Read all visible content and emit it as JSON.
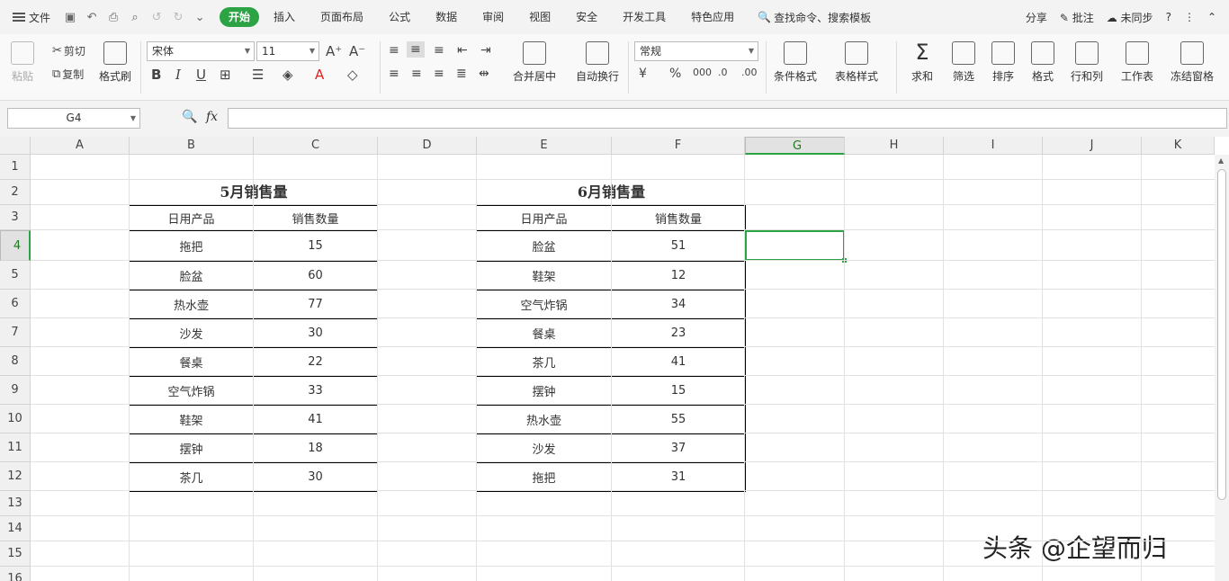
{
  "menu": {
    "file": "文件",
    "tabs": [
      "开始",
      "插入",
      "页面布局",
      "公式",
      "数据",
      "审阅",
      "视图",
      "安全",
      "开发工具",
      "特色应用"
    ],
    "active_tab": "开始",
    "search": "查找命令、搜索模板",
    "share": "分享",
    "comment": "批注",
    "sync": "未同步",
    "help": "?"
  },
  "ribbon": {
    "paste": "粘贴",
    "cut": "剪切",
    "copy": "复制",
    "format_painter": "格式刷",
    "font": "宋体",
    "size": "11",
    "merge": "合并居中",
    "wrap": "自动换行",
    "number_format": "常规",
    "cond_format": "条件格式",
    "table_style": "表格样式",
    "sum": "求和",
    "filter": "筛选",
    "sort": "排序",
    "format": "格式",
    "rows_cols": "行和列",
    "sheet": "工作表",
    "freeze": "冻结窗格"
  },
  "formula": {
    "cell_ref": "G4",
    "fx": "fx",
    "value": ""
  },
  "columns": [
    "A",
    "B",
    "C",
    "D",
    "E",
    "F",
    "G",
    "H",
    "I",
    "J",
    "K"
  ],
  "selected_col": "G",
  "rows": [
    "1",
    "2",
    "3",
    "4",
    "5",
    "6",
    "7",
    "8",
    "9",
    "10",
    "11",
    "12",
    "13",
    "14",
    "15",
    "16"
  ],
  "selected_row": "4",
  "table_may": {
    "title": "5月销售量",
    "headers": [
      "日用产品",
      "销售数量"
    ],
    "rows": [
      [
        "拖把",
        "15"
      ],
      [
        "脸盆",
        "60"
      ],
      [
        "热水壶",
        "77"
      ],
      [
        "沙发",
        "30"
      ],
      [
        "餐桌",
        "22"
      ],
      [
        "空气炸锅",
        "33"
      ],
      [
        "鞋架",
        "41"
      ],
      [
        "摆钟",
        "18"
      ],
      [
        "茶几",
        "30"
      ]
    ]
  },
  "table_june": {
    "title": "6月销售量",
    "headers": [
      "日用产品",
      "销售数量"
    ],
    "rows": [
      [
        "脸盆",
        "51"
      ],
      [
        "鞋架",
        "12"
      ],
      [
        "空气炸锅",
        "34"
      ],
      [
        "餐桌",
        "23"
      ],
      [
        "茶几",
        "41"
      ],
      [
        "摆钟",
        "15"
      ],
      [
        "热水壶",
        "55"
      ],
      [
        "沙发",
        "37"
      ],
      [
        "拖把",
        "31"
      ]
    ]
  },
  "watermark": "头条 @企望而归"
}
